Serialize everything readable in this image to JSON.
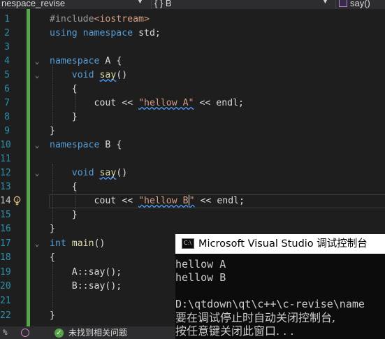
{
  "navbar": {
    "project": "nespace_revise",
    "scope": "{ } B",
    "member": "say()"
  },
  "editor": {
    "lines": [
      {
        "n": "1"
      },
      {
        "n": "2"
      },
      {
        "n": "3"
      },
      {
        "n": "4"
      },
      {
        "n": "5"
      },
      {
        "n": "6"
      },
      {
        "n": "7"
      },
      {
        "n": "8"
      },
      {
        "n": "9"
      },
      {
        "n": "10"
      },
      {
        "n": "11"
      },
      {
        "n": "12"
      },
      {
        "n": "13"
      },
      {
        "n": "14"
      },
      {
        "n": "15"
      },
      {
        "n": "16"
      },
      {
        "n": "17"
      },
      {
        "n": "18"
      },
      {
        "n": "19"
      },
      {
        "n": "20"
      },
      {
        "n": "21"
      },
      {
        "n": "22"
      }
    ],
    "tokens": {
      "include": "#include",
      "iostream": "<iostream>",
      "using": "using",
      "namespace": "namespace",
      "std": "std;",
      "A": "A",
      "B": "B",
      "open_brace": "{",
      "close_brace": "}",
      "void": "void",
      "say": "say",
      "parens": "()",
      "cout": "cout",
      "shift": "<<",
      "str_a": "\"hellow A\"",
      "str_b_start": "\"hellow B",
      "str_b_end": "\"",
      "endl": "endl;",
      "int": "int",
      "main": "main",
      "call_a": "A::say();",
      "call_b": "B::say();"
    }
  },
  "console": {
    "title": "Microsoft Visual Studio 调试控制台",
    "icon_label": "C:\\",
    "lines": [
      "hellow A",
      "hellow B",
      "",
      "D:\\qtdown\\qt\\c++\\c-revise\\name",
      "要在调试停止时自动关闭控制台,",
      "按任意键关闭此窗口. . ."
    ]
  },
  "statusbar": {
    "zoom": "%",
    "message": "未找到相关问题"
  },
  "colors": {
    "keyword": "#569cd6",
    "function": "#dcdcaa",
    "string": "#d69d85",
    "line_number": "#2b91af",
    "change_bar": "#57a64a"
  },
  "icons": [
    "lightbulb-icon",
    "fold-icon",
    "cube-icon",
    "console-icon",
    "check-icon",
    "copilot-icon"
  ]
}
